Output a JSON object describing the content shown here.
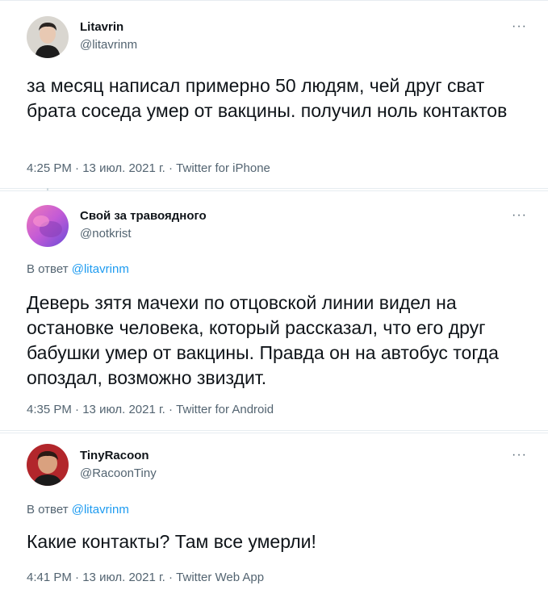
{
  "tweets": [
    {
      "name": "Litavrin",
      "handle": "@litavrinm",
      "more": "···",
      "text": "за месяц написал примерно 50 людям, чей друг сват брата соседа умер от вакцины. получил ноль контактов",
      "time": "4:25 PM",
      "sep": " · ",
      "date": "13 июл. 2021 г.",
      "source": "Twitter for iPhone",
      "avatar_icon": "man-portrait-avatar"
    },
    {
      "name": "Свой за травоядного",
      "handle": "@notkrist",
      "more": "···",
      "reply_prefix": "В ответ",
      "reply_mention": "@litavrinm",
      "text": "Деверь зятя мачехи по отцовской линии видел на остановке человека, который рассказал, что его друг бабушки умер от вакцины. Правда он на автобус тогда опоздал, возможно звиздит.",
      "time": "4:35 PM",
      "sep": " · ",
      "date": "13 июл. 2021 г.",
      "source": "Twitter for Android",
      "avatar_icon": "pink-purple-abstract-avatar"
    },
    {
      "name": "TinyRacoon",
      "handle": "@RacoonTiny",
      "more": "···",
      "reply_prefix": "В ответ",
      "reply_mention": "@litavrinm",
      "text": "Какие контакты? Там все умерли!",
      "time": "4:41 PM",
      "sep": " · ",
      "date": "13 июл. 2021 г.",
      "source": "Twitter Web App",
      "avatar_icon": "man-red-background-avatar"
    }
  ],
  "colors": {
    "text": "#0f1419",
    "secondary": "#536471",
    "link": "#1d9bf0",
    "border": "#e6ecf0"
  }
}
